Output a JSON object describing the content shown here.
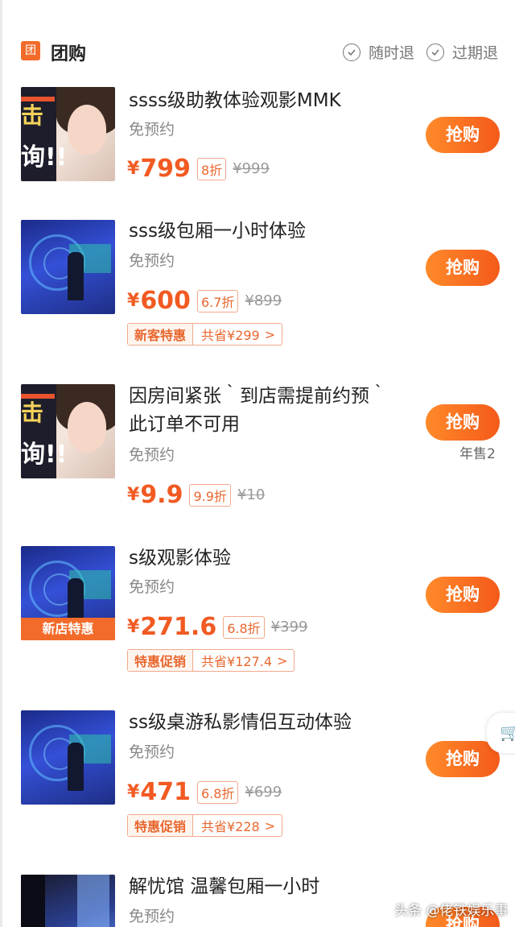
{
  "header": {
    "badge": "团",
    "title": "团购",
    "guarantees": [
      "随时退",
      "过期退"
    ]
  },
  "deals": [
    {
      "title": "ssss级助教体验观影MMK",
      "sub": "免预约",
      "currency": "¥",
      "price": "799",
      "discount": "8折",
      "original": "¥999",
      "buy_label": "抢购",
      "thumb_text": [
        "击",
        "询!!"
      ]
    },
    {
      "title": "sss级包厢一小时体验",
      "sub": "免预约",
      "currency": "¥",
      "price": "600",
      "discount": "6.7折",
      "original": "¥899",
      "promo_label": "新客特惠",
      "promo_save": "共省¥299",
      "buy_label": "抢购"
    },
    {
      "title_line1": "因房间紧张｀到店需提前约预｀",
      "title_line2": "此订单不可用",
      "sub": "免预约",
      "currency": "¥",
      "price": "9.9",
      "discount": "9.9折",
      "original": "¥10",
      "buy_label": "抢购",
      "sold": "年售2",
      "thumb_text": [
        "击",
        "询!!"
      ]
    },
    {
      "title": "s级观影体验",
      "sub": "免预约",
      "currency": "¥",
      "price": "271.6",
      "discount": "6.8折",
      "original": "¥399",
      "promo_label": "特惠促销",
      "promo_save": "共省¥127.4",
      "buy_label": "抢购",
      "thumb_tag": "新店特惠"
    },
    {
      "title": "ss级桌游私影情侣互动体验",
      "sub": "免预约",
      "currency": "¥",
      "price": "471",
      "discount": "6.8折",
      "original": "¥699",
      "promo_label": "特惠促销",
      "promo_save": "共省¥228",
      "buy_label": "抢购"
    },
    {
      "title": "解忧馆 温馨包厢一小时",
      "sub": "免预约",
      "buy_label": "抢购"
    }
  ],
  "promo_arrow": ">",
  "watermark": "头条 @佬铁娱乐事",
  "colors": {
    "accent": "#f15a22",
    "button": "#f45a1a",
    "muted": "#888888"
  }
}
